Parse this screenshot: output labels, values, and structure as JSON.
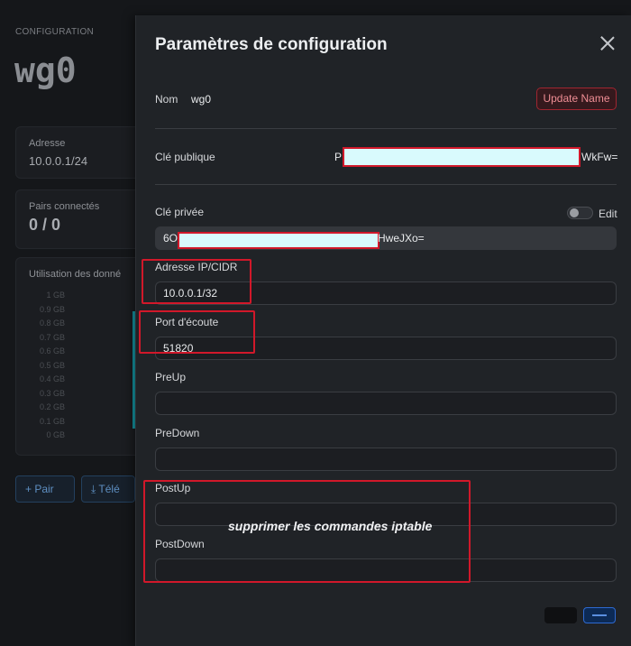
{
  "background": {
    "section_label": "CONFIGURATION",
    "interface_name": "wg0",
    "cards": [
      {
        "label": "Adresse",
        "value": "10.0.0.1/24"
      },
      {
        "label": "Pairs connectés",
        "value": "0 / 0"
      },
      {
        "label": "Utilisation des donné"
      }
    ],
    "chart_axis_labels": [
      "1 GB",
      "0.9 GB",
      "0.8 GB",
      "0.7 GB",
      "0.6 GB",
      "0.5 GB",
      "0.4 GB",
      "0.3 GB",
      "0.2 GB",
      "0.1 GB",
      "0 GB"
    ],
    "buttons": {
      "pair": "+ Pair",
      "download": "⤓ Télé"
    }
  },
  "modal": {
    "title": "Paramètres de configuration",
    "name": {
      "label": "Nom",
      "value": "wg0",
      "update_button": "Update Name"
    },
    "public_key": {
      "label": "Clé publique",
      "value_start": "P",
      "value_end": "WkFw="
    },
    "private_key": {
      "label": "Clé privée",
      "edit_label": "Edit",
      "value_start": "6O",
      "value_end": "HweJXo="
    },
    "address": {
      "label": "Adresse IP/CIDR",
      "value": "10.0.0.1/32"
    },
    "listen_port": {
      "label": "Port d'écoute",
      "value": "51820"
    },
    "pre_up": {
      "label": "PreUp",
      "value": ""
    },
    "pre_down": {
      "label": "PreDown",
      "value": ""
    },
    "post_up": {
      "label": "PostUp",
      "value": ""
    },
    "post_down": {
      "label": "PostDown",
      "value": ""
    },
    "annotation": "supprimer les commandes iptable"
  },
  "colors": {
    "highlight_red": "#d1182a",
    "mask_cyan": "#d9fafd",
    "accent_blue": "#2e6ad1",
    "accent_teal": "#159aa8"
  },
  "icons": [
    "close-icon",
    "plus-icon",
    "download-icon"
  ]
}
